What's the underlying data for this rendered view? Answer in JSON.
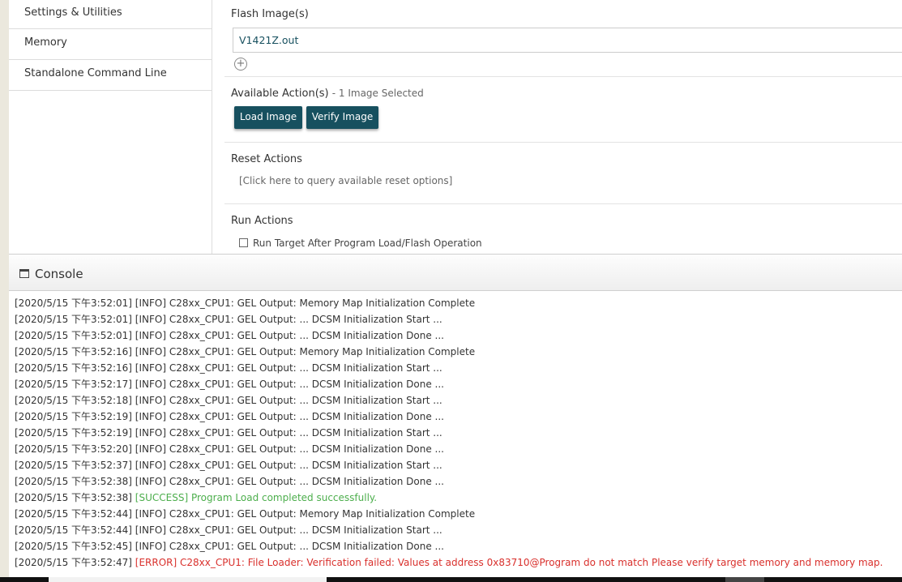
{
  "sidebar": {
    "items": [
      {
        "label": "Settings & Utilities"
      },
      {
        "label": "Memory"
      },
      {
        "label": "Standalone Command Line"
      }
    ]
  },
  "flash": {
    "title": "Flash Image(s)",
    "file": "V1421Z.out",
    "add_icon": "plus-circle-icon"
  },
  "actions": {
    "title": "Available Action(s)",
    "subtitle": "- 1 Image Selected",
    "load_label": "Load Image",
    "verify_label": "Verify Image"
  },
  "reset": {
    "title": "Reset Actions",
    "query_text": "[Click here to query available reset options]"
  },
  "run": {
    "title": "Run Actions",
    "option_label": "Run Target After Program Load/Flash Operation",
    "checked": false
  },
  "console": {
    "title": "Console",
    "icon": "window-icon",
    "lines": [
      {
        "ts": "[2020/5/15 下午3:52:01]",
        "msg": "[INFO] C28xx_CPU1: GEL Output: Memory Map Initialization Complete",
        "level": "INFO"
      },
      {
        "ts": "[2020/5/15 下午3:52:01]",
        "msg": "[INFO] C28xx_CPU1: GEL Output: ... DCSM Initialization Start ...",
        "level": "INFO"
      },
      {
        "ts": "[2020/5/15 下午3:52:01]",
        "msg": "[INFO] C28xx_CPU1: GEL Output: ... DCSM Initialization Done ...",
        "level": "INFO"
      },
      {
        "ts": "[2020/5/15 下午3:52:16]",
        "msg": "[INFO] C28xx_CPU1: GEL Output: Memory Map Initialization Complete",
        "level": "INFO"
      },
      {
        "ts": "[2020/5/15 下午3:52:16]",
        "msg": "[INFO] C28xx_CPU1: GEL Output: ... DCSM Initialization Start ...",
        "level": "INFO"
      },
      {
        "ts": "[2020/5/15 下午3:52:17]",
        "msg": "[INFO] C28xx_CPU1: GEL Output: ... DCSM Initialization Done ...",
        "level": "INFO"
      },
      {
        "ts": "[2020/5/15 下午3:52:18]",
        "msg": "[INFO] C28xx_CPU1: GEL Output: ... DCSM Initialization Start ...",
        "level": "INFO"
      },
      {
        "ts": "[2020/5/15 下午3:52:19]",
        "msg": "[INFO] C28xx_CPU1: GEL Output: ... DCSM Initialization Done ...",
        "level": "INFO"
      },
      {
        "ts": "[2020/5/15 下午3:52:19]",
        "msg": "[INFO] C28xx_CPU1: GEL Output: ... DCSM Initialization Start ...",
        "level": "INFO"
      },
      {
        "ts": "[2020/5/15 下午3:52:20]",
        "msg": "[INFO] C28xx_CPU1: GEL Output: ... DCSM Initialization Done ...",
        "level": "INFO"
      },
      {
        "ts": "[2020/5/15 下午3:52:37]",
        "msg": "[INFO] C28xx_CPU1: GEL Output: ... DCSM Initialization Start ...",
        "level": "INFO"
      },
      {
        "ts": "[2020/5/15 下午3:52:38]",
        "msg": "[INFO] C28xx_CPU1: GEL Output: ... DCSM Initialization Done ...",
        "level": "INFO"
      },
      {
        "ts": "[2020/5/15 下午3:52:38]",
        "msg": "[SUCCESS] Program Load completed successfully.",
        "level": "SUCCESS"
      },
      {
        "ts": "[2020/5/15 下午3:52:44]",
        "msg": "[INFO] C28xx_CPU1: GEL Output: Memory Map Initialization Complete",
        "level": "INFO"
      },
      {
        "ts": "[2020/5/15 下午3:52:44]",
        "msg": "[INFO] C28xx_CPU1: GEL Output: ... DCSM Initialization Start ...",
        "level": "INFO"
      },
      {
        "ts": "[2020/5/15 下午3:52:45]",
        "msg": "[INFO] C28xx_CPU1: GEL Output: ... DCSM Initialization Done ...",
        "level": "INFO"
      },
      {
        "ts": "[2020/5/15 下午3:52:47]",
        "msg": "[ERROR] C28xx_CPU1: File Loader: Verification failed: Values at address 0x83710@Program do not match Please verify target memory and memory map.",
        "level": "ERROR"
      }
    ]
  },
  "colors": {
    "accent": "#17505f",
    "success": "#4cae4c",
    "error": "#d9302c"
  }
}
